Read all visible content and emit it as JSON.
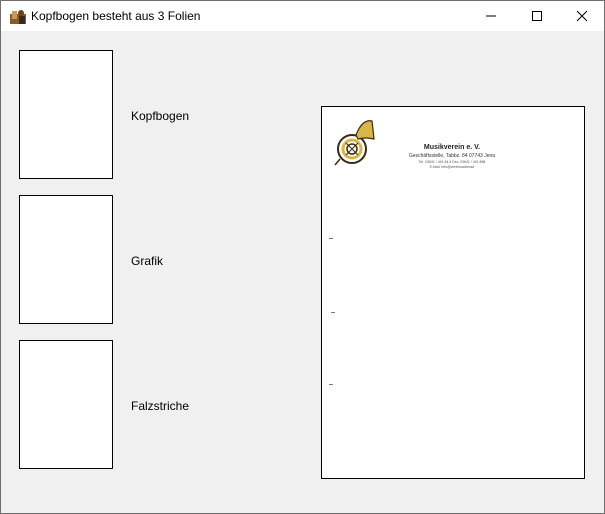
{
  "window": {
    "title": "Kopfbogen besteht aus 3 Folien",
    "icon": "app-icon"
  },
  "controls": {
    "minimize_icon": "minimize-icon",
    "maximize_icon": "maximize-icon",
    "close_icon": "close-icon"
  },
  "slides": [
    {
      "label": "Kopfbogen"
    },
    {
      "label": "Grafik"
    },
    {
      "label": "Falzstriche"
    }
  ],
  "preview": {
    "org_name": "Musikverein e. V.",
    "address_line": "Geschäftsstelle, Tabbz. 84 07743 Jena",
    "contact_line": "Tel. 03641 / 491 84 4 Fax: 03641 / 491 888",
    "email_line": "E-Mail: info@vereinsadresse",
    "logo_icon": "french-horn-icon",
    "logo_color": "#d9b64a"
  }
}
